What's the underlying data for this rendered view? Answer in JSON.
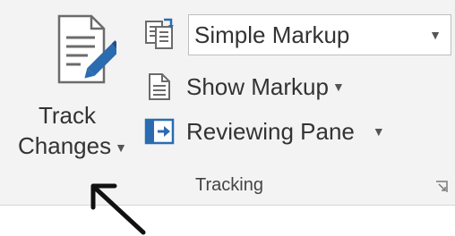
{
  "tracking": {
    "track_changes": {
      "line1": "Track",
      "line2": "Changes"
    },
    "markup_select": {
      "value": "Simple Markup"
    },
    "show_markup": {
      "label": "Show Markup"
    },
    "reviewing_pane": {
      "label": "Reviewing Pane"
    },
    "group_label": "Tracking"
  },
  "colors": {
    "accent_blue": "#2b6cb0",
    "ribbon_bg": "#f3f3f3"
  },
  "icons": [
    "track-changes-icon",
    "display-for-review-icon",
    "show-markup-icon",
    "reviewing-pane-icon",
    "dialog-launcher-icon",
    "pointer-arrow-icon"
  ]
}
